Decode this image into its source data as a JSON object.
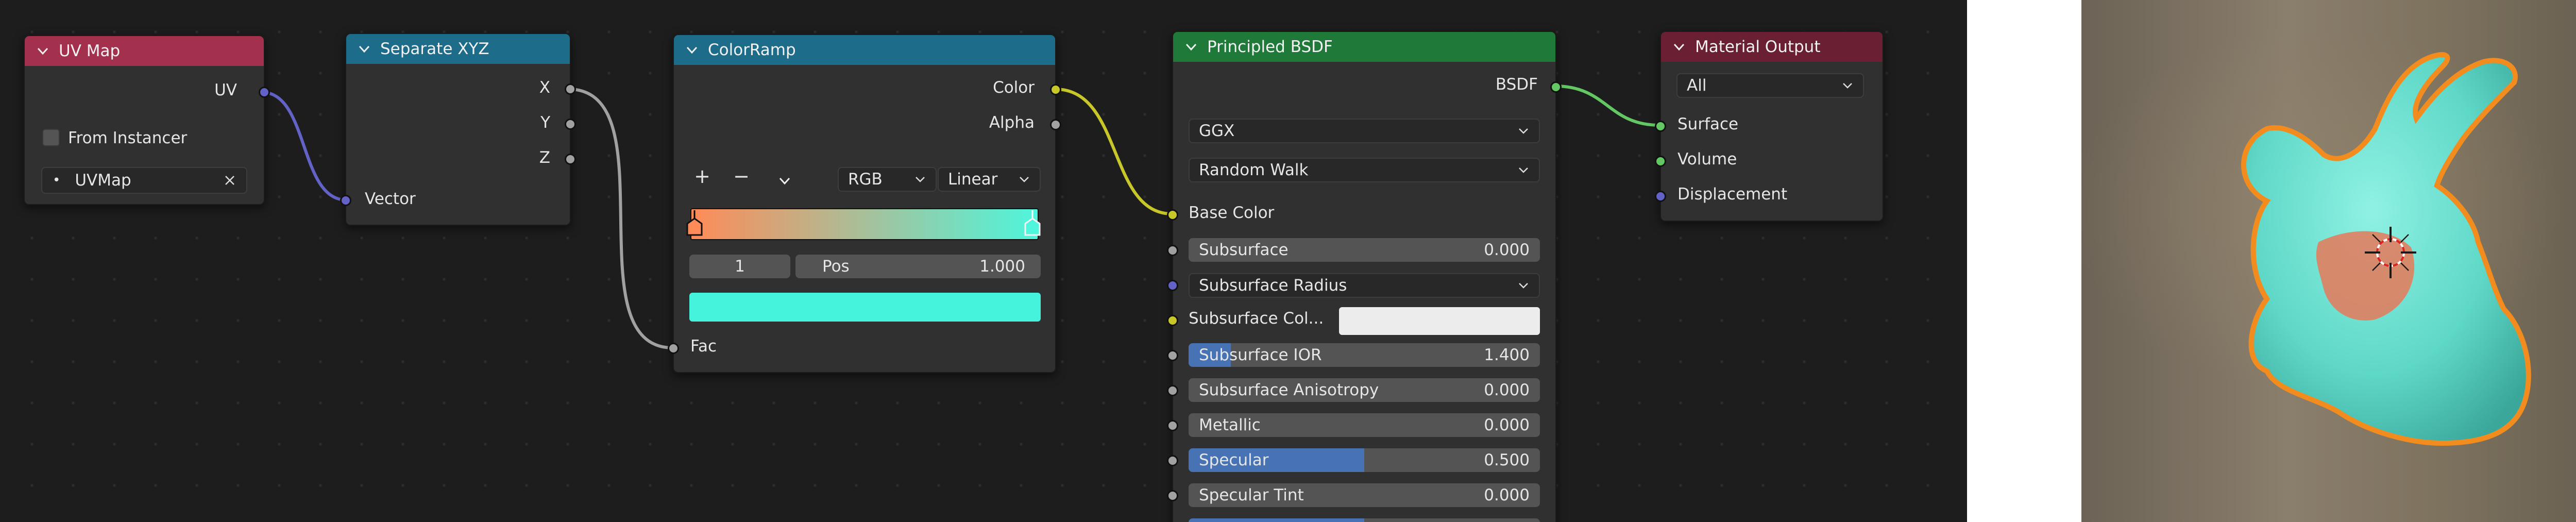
{
  "colors": {
    "uv_map_header": "#a3314d",
    "separate_header": "#1d6c89",
    "colorramp_header": "#1d6c89",
    "principled_header": "#1f7a3a",
    "output_header": "#6b1f33",
    "socket_vector": "#6363c7",
    "socket_float": "#a1a1a1",
    "socket_color": "#c7c729",
    "socket_shader": "#63c763",
    "slider_fill": "#4772b3",
    "ramp_start": "#ff8b58",
    "ramp_end": "#4ff5dc",
    "ramp_selected_color": "#45f3dc",
    "object_color": "#5fd8c8",
    "object_outline": "#f28c1e"
  },
  "uv_map": {
    "title": "UV Map",
    "output_uv": "UV",
    "from_instancer": "From Instancer",
    "uvmap_value": "UVMap"
  },
  "separate_xyz": {
    "title": "Separate XYZ",
    "out_x": "X",
    "out_y": "Y",
    "out_z": "Z",
    "in_vector": "Vector"
  },
  "colorramp": {
    "title": "ColorRamp",
    "out_color": "Color",
    "out_alpha": "Alpha",
    "add_btn": "+",
    "remove_btn": "−",
    "color_mode": "RGB",
    "interpolation": "Linear",
    "stop_index": "1",
    "pos_label": "Pos",
    "pos_value": "1.000",
    "in_fac": "Fac"
  },
  "principled": {
    "title": "Principled BSDF",
    "out_bsdf": "BSDF",
    "distribution": "GGX",
    "subsurface_method": "Random Walk",
    "base_color": "Base Color",
    "subsurface": {
      "label": "Subsurface",
      "value": "0.000",
      "fill": 0.0
    },
    "subsurface_radius": "Subsurface Radius",
    "subsurface_color": "Subsurface Col...",
    "subsurface_ior": {
      "label": "Subsurface IOR",
      "value": "1.400",
      "fill": 0.12
    },
    "subsurface_anisotropy": {
      "label": "Subsurface Anisotropy",
      "value": "0.000",
      "fill": 0.0
    },
    "metallic": {
      "label": "Metallic",
      "value": "0.000",
      "fill": 0.0
    },
    "specular": {
      "label": "Specular",
      "value": "0.500",
      "fill": 0.5
    },
    "specular_tint": {
      "label": "Specular Tint",
      "value": "0.000",
      "fill": 0.0
    }
  },
  "material_output": {
    "title": "Material Output",
    "target": "All",
    "surface": "Surface",
    "volume": "Volume",
    "displacement": "Displacement"
  },
  "icons": {
    "collapse": "chevron-down-icon",
    "dropdown": "chevron-down-icon",
    "clear": "close-icon",
    "uv": "uv-dot-icon",
    "cursor": "3d-cursor-icon"
  }
}
